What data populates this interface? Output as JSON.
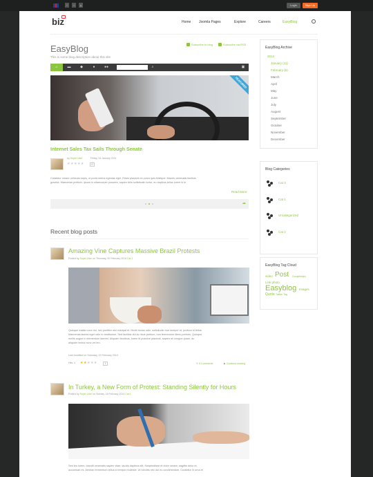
{
  "topbar": {
    "login": "Login",
    "signup": "Sign Up",
    "social": [
      "f",
      "t",
      "g"
    ]
  },
  "header": {
    "logo": "biz",
    "nav": [
      {
        "label": "Home",
        "active": false
      },
      {
        "label": "Joomla Pages",
        "active": false
      },
      {
        "label": "Explore",
        "active": false
      },
      {
        "label": "Careers",
        "active": false
      },
      {
        "label": "EasyBlog",
        "active": true
      }
    ]
  },
  "blog": {
    "title": "EasyBlog",
    "description": "This is some blog description about this site",
    "subscribe_blog": "Subscribe to blog",
    "subscribe_rss": "Subscribe via RSS"
  },
  "featured": {
    "ribbon": "FEATURED",
    "title": "Internet Sales Tax Sails Through Senate",
    "by_prefix": "by",
    "author": "Super User",
    "date": "Friday, 24 January 2014",
    "rating_count": "0",
    "excerpt_line1": "Curabitur ornare vehicula turpis, ut porta metus egestas eget. Etiam placerat ex purus quis tristique. Mauris venenatis facilisis",
    "excerpt_line2": "gravida. Maecenas pretium, ipsum in ullamcorper posuere, sapien felis sollicitudin tortor, eu dapibus tellus lorem in le",
    "read_more": "Read More"
  },
  "recent": {
    "heading": "Recent blog posts",
    "posts": [
      {
        "title": "Amazing Vine Captures Massive Brazil Protests",
        "posted_by": "Posted by",
        "author": "Super User",
        "date": "on Thursday, 20 February 2014",
        "category": "Cat 1",
        "body_1": "Quisque mattis nunc dui, nec porttitor nisl volutpat et. Morbi lectus odio, sollicitudin non semper et, pretium id tellus.",
        "body_2": "Maecenas lacinia eget odio in vestibulum. Sed facilisis dui ac risus pretium, non fermentum libero pretium. Quisque",
        "body_3": "mollis augue in elementum laoreet. Aliquam faucibus, lorem id posuere placerat, sapien mi congue quam, ac",
        "body_4": "aliquam lectus nunc vel leo.",
        "modified": "Last modified on Saturday, 22 February 2014",
        "hits": "Hits: 4",
        "rating_count": "1",
        "comments": "0 Comments",
        "continue": "Continue reading"
      },
      {
        "title": "In Turkey, a New Form of Protest: Standing Silently for Hours",
        "posted_by": "Posted by",
        "author": "Super User",
        "date": "on Sunday, 16 February 2014",
        "category": "Cat 1",
        "body_1": "Sed leo lorem, blandit venenatis sapien vitae, iaculis dapibus elit. Suspendisse et dolor ornare, sagittis dolor et,",
        "body_2": "accumsan mi. Aenean fermentum tellus id tempor molestie. Ut lobortis nec dui eu condimentum. Curabitur in urna et"
      }
    ]
  },
  "sidebar": {
    "archive": {
      "title": "EasyBlog Archive",
      "year": "2014",
      "months": [
        "January (11)",
        "February (5)",
        "March",
        "April",
        "May",
        "June",
        "July",
        "August",
        "September",
        "October",
        "November",
        "December"
      ]
    },
    "categories": {
      "title": "Blog Categories",
      "items": [
        "Cat 3",
        "Cat 1",
        "Uncategorized",
        "Cat 2"
      ]
    },
    "tags": {
      "title": "EasyBlog Tag Cloud",
      "items": [
        "video",
        "Post",
        "Googlemaps",
        "Link photo",
        "Easyblog",
        "Images",
        "Quote",
        "Twitter Tag"
      ]
    }
  },
  "colors": {
    "accent": "#8cc63f",
    "signup": "#f26a23",
    "toolbar": "#3b3b3b"
  }
}
